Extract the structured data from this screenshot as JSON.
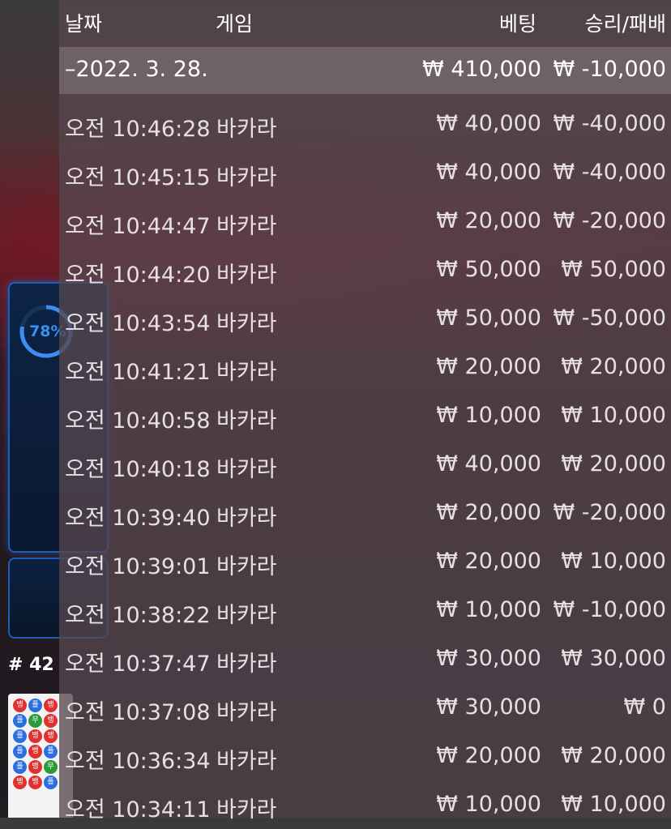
{
  "background": {
    "progress_label": "78%",
    "round_label": "# 42",
    "roadmap": [
      [
        {
          "t": "뱅",
          "c": "red"
        },
        {
          "t": "플",
          "c": "blue"
        },
        {
          "t": "뱅",
          "c": "red"
        }
      ],
      [
        {
          "t": "플",
          "c": "blue"
        },
        {
          "t": "무",
          "c": "green"
        },
        {
          "t": "뱅",
          "c": "red"
        }
      ],
      [
        {
          "t": "플",
          "c": "blue"
        },
        {
          "t": "뱅",
          "c": "red"
        },
        {
          "t": "뱅",
          "c": "red"
        }
      ],
      [
        {
          "t": "플",
          "c": "blue"
        },
        {
          "t": "뱅",
          "c": "red"
        },
        {
          "t": "플",
          "c": "blue"
        }
      ],
      [
        {
          "t": "플",
          "c": "blue"
        },
        {
          "t": "뱅",
          "c": "red"
        },
        {
          "t": "무",
          "c": "green"
        }
      ],
      [
        {
          "t": "뱅",
          "c": "red"
        },
        {
          "t": "뱅",
          "c": "red"
        },
        {
          "t": "플",
          "c": "blue"
        }
      ]
    ],
    "colors": {
      "panel_border": "#1d5fb8",
      "progress": "#3e8df0"
    }
  },
  "history": {
    "headers": {
      "date": "날짜",
      "game": "게임",
      "bet": "베팅",
      "result": "승리/패배"
    },
    "summary": {
      "date": "–2022. 3. 28.",
      "bet": "₩ 410,000",
      "result": "₩ -10,000"
    },
    "rows": [
      {
        "time": "오전 10:46:28",
        "game": "바카라",
        "bet": "₩ 40,000",
        "result": "₩ -40,000"
      },
      {
        "time": "오전 10:45:15",
        "game": "바카라",
        "bet": "₩ 40,000",
        "result": "₩ -40,000"
      },
      {
        "time": "오전 10:44:47",
        "game": "바카라",
        "bet": "₩ 20,000",
        "result": "₩ -20,000"
      },
      {
        "time": "오전 10:44:20",
        "game": "바카라",
        "bet": "₩ 50,000",
        "result": "₩ 50,000"
      },
      {
        "time": "오전 10:43:54",
        "game": "바카라",
        "bet": "₩ 50,000",
        "result": "₩ -50,000"
      },
      {
        "time": "오전 10:41:21",
        "game": "바카라",
        "bet": "₩ 20,000",
        "result": "₩ 20,000"
      },
      {
        "time": "오전 10:40:58",
        "game": "바카라",
        "bet": "₩ 10,000",
        "result": "₩ 10,000"
      },
      {
        "time": "오전 10:40:18",
        "game": "바카라",
        "bet": "₩ 40,000",
        "result": "₩ 20,000"
      },
      {
        "time": "오전 10:39:40",
        "game": "바카라",
        "bet": "₩ 20,000",
        "result": "₩ -20,000"
      },
      {
        "time": "오전 10:39:01",
        "game": "바카라",
        "bet": "₩ 20,000",
        "result": "₩ 10,000"
      },
      {
        "time": "오전 10:38:22",
        "game": "바카라",
        "bet": "₩ 10,000",
        "result": "₩ -10,000"
      },
      {
        "time": "오전 10:37:47",
        "game": "바카라",
        "bet": "₩ 30,000",
        "result": "₩ 30,000"
      },
      {
        "time": "오전 10:37:08",
        "game": "바카라",
        "bet": "₩ 30,000",
        "result": "₩ 0"
      },
      {
        "time": "오전 10:36:34",
        "game": "바카라",
        "bet": "₩ 20,000",
        "result": "₩ 20,000"
      },
      {
        "time": "오전 10:34:11",
        "game": "바카라",
        "bet": "₩ 10,000",
        "result": "₩ 10,000"
      }
    ]
  }
}
